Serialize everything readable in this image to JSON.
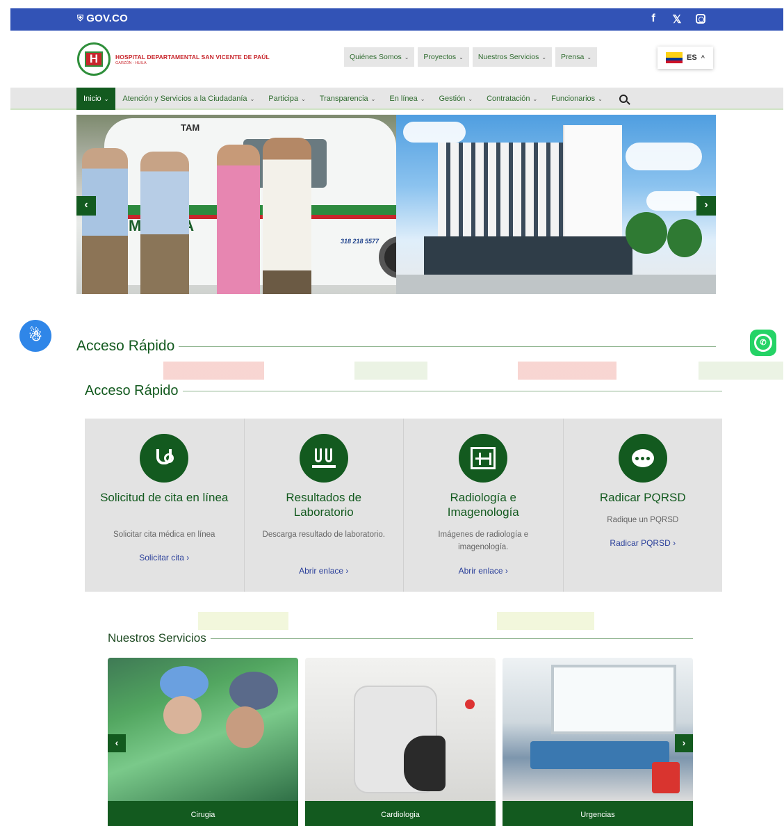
{
  "gov_bar": {
    "logo": "GOV.CO",
    "social": [
      "f",
      "𝕏",
      "instagram"
    ]
  },
  "header": {
    "hospital_name": "HOSPITAL DEPARTAMENTAL SAN VICENTE DE PAÚL",
    "location": "GARZÓN - HUILA",
    "top_nav": [
      {
        "label": "Quiénes Somos"
      },
      {
        "label": "Proyectos"
      },
      {
        "label": "Nuestros Servicios"
      },
      {
        "label": "Prensa"
      }
    ],
    "language": "ES",
    "colors": {
      "brand_green": "#135a1f",
      "gov_blue": "#3253b6",
      "logo_red": "#c8262c"
    }
  },
  "main_nav": {
    "items": [
      {
        "label": "Inicio",
        "active": true
      },
      {
        "label": "Atención y Servicios a la Ciudadanía"
      },
      {
        "label": "Participa"
      },
      {
        "label": "Transparencia"
      },
      {
        "label": "En línea"
      },
      {
        "label": "Gestión"
      },
      {
        "label": "Contratación"
      },
      {
        "label": "Funcionarios"
      }
    ]
  },
  "slider": {
    "ambulance_text": "MB     NCIA",
    "ambulance_brand": "TAM",
    "ambulance_phone": "318 218 5577",
    "prev": "‹",
    "next": "›"
  },
  "quick_access": {
    "title_outer": "Acceso Rápido",
    "title_inner": "Acceso Rápido",
    "cards": [
      {
        "icon": "stethoscope-icon",
        "title": "Solicitud de cita en línea",
        "desc": "Solicitar cita médica en línea",
        "link": "Solicitar cita ›"
      },
      {
        "icon": "test-tubes-icon",
        "title": "Resultados de Laboratorio",
        "desc": "Descarga resultado de laboratorio.",
        "link": "Abrir enlace ›"
      },
      {
        "icon": "xray-icon",
        "title": "Radiología e Imagenología",
        "desc": "Imágenes de radiología e imagenología.",
        "link": "Abrir enlace ›"
      },
      {
        "icon": "chat-icon",
        "title": "Radicar PQRSD",
        "desc": "Radique un PQRSD",
        "link": "Radicar PQRSD ›"
      }
    ]
  },
  "services": {
    "title": "Nuestros Servicios",
    "items": [
      {
        "label": "Cirugia"
      },
      {
        "label": "Cardiologia"
      },
      {
        "label": "Urgencias"
      }
    ],
    "prev": "‹",
    "next": "›"
  }
}
